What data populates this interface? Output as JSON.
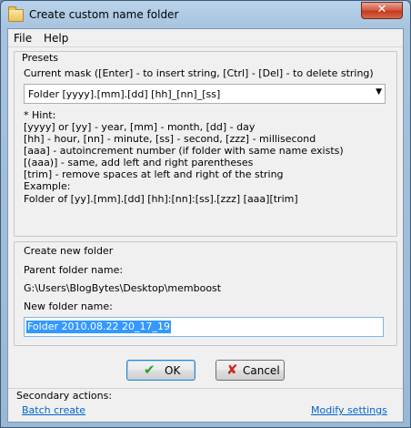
{
  "window": {
    "title": "Create custom name folder",
    "close_glyph": "✕"
  },
  "menu": [
    "File",
    "Help"
  ],
  "presets": {
    "heading": "Presets",
    "mask_label": "Current mask  ([Enter] - to insert string, [Ctrl] - [Del] - to delete string)",
    "mask_value": "Folder [yyyy].[mm].[dd] [hh]_[nn]_[ss]",
    "dropdown_glyph": "▼",
    "hint_lines": [
      "* Hint:",
      "[yyyy] or [yy] - year, [mm] - month, [dd] - day",
      "[hh] - hour, [nn] - minute, [ss] - second, [zzz] - millisecond",
      "[aaa] - autoincrement number (if folder with same name exists)",
      "[(aaa)] - same, add left and right parentheses",
      "[trim] - remove spaces at left and right of the string",
      "Example:",
      "Folder of [yy].[mm].[dd] [hh]:[nn]:[ss].[zzz] [aaa][trim]"
    ]
  },
  "new_folder": {
    "heading": "Create new folder",
    "parent_label": "Parent folder name:",
    "parent_path": "G:\\Users\\BlogBytes\\Desktop\\memboost",
    "name_label": "New folder name:",
    "name_value": "Folder 2010.08.22 20_17_19"
  },
  "buttons": {
    "ok": "OK",
    "ok_icon": "✔",
    "cancel": "Cancel",
    "cancel_icon": "✘"
  },
  "footer": {
    "label": "Secondary actions:",
    "batch_create": "Batch create",
    "modify_settings": "Modify settings"
  },
  "colors": {
    "ok_icon": "#2e9b2e",
    "cancel_icon": "#cc2a1f",
    "link": "#0066cc",
    "selection": "#3399ff"
  }
}
